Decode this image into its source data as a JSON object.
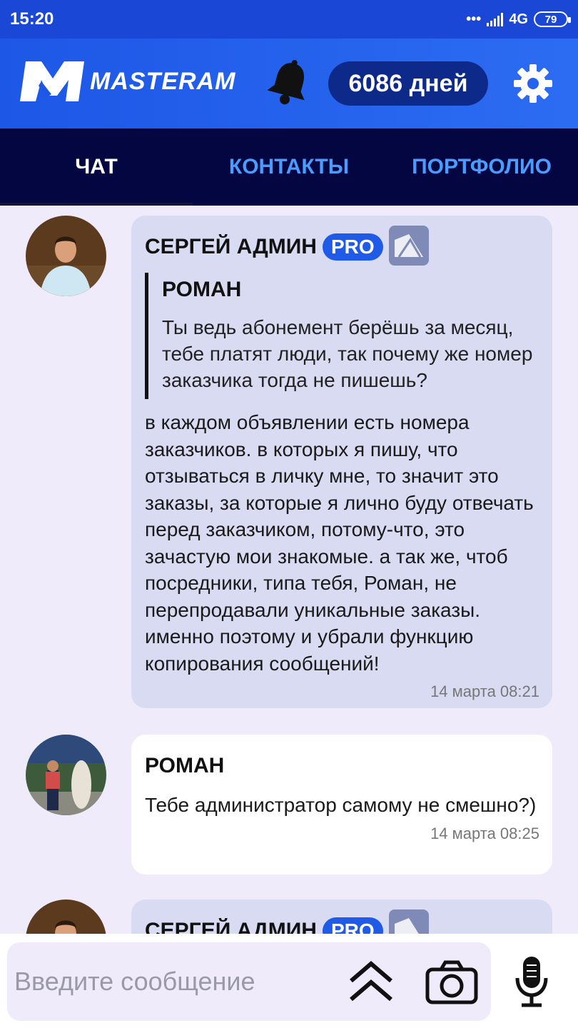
{
  "status_bar": {
    "time": "15:20",
    "network": "4G",
    "battery": "79"
  },
  "header": {
    "logo_text": "MASTERAM",
    "days_label": "6086 дней"
  },
  "tabs": [
    {
      "label": "ЧАТ",
      "active": true
    },
    {
      "label": "КОНТАКТЫ",
      "active": false
    },
    {
      "label": "ПОРТФОЛИО",
      "active": false
    }
  ],
  "messages": [
    {
      "author": "СЕРГЕЙ АДМИН",
      "badge": "PRO",
      "quote": {
        "author": "РОМАН",
        "text": "Ты ведь абонемент берёшь за месяц, тебе платят люди, так почему же номер заказчика тогда не пишешь?"
      },
      "text": "в каждом объявлении есть номера заказчиков. в которых я пишу, что отзываться в личку мне, то значит это заказы, за которые я лично буду отвечать перед заказчиком, потому-что, это зачастую мои знакомые. а так же, чтоб посредники, типа тебя, Роман, не перепродавали уникальные заказы. именно поэтому и убрали функцию копирования сообщений!",
      "time": "14 марта 08:21"
    },
    {
      "author": "РОМАН",
      "text": "Тебе администратор самому не смешно?)",
      "time": "14 марта 08:25"
    },
    {
      "author": "СЕРГЕЙ АДМИН",
      "badge": "PRO"
    }
  ],
  "composer": {
    "placeholder": "Введите сообщение"
  },
  "icons": [
    "bell-icon",
    "gear-icon",
    "scroll-up-icon",
    "camera-icon",
    "microphone-icon"
  ],
  "colors": {
    "brand_blue": "#1d57e6",
    "tab_bar": "#030640",
    "pro_badge": "#1f5be6",
    "admin_bubble": "#d9dbf2"
  }
}
